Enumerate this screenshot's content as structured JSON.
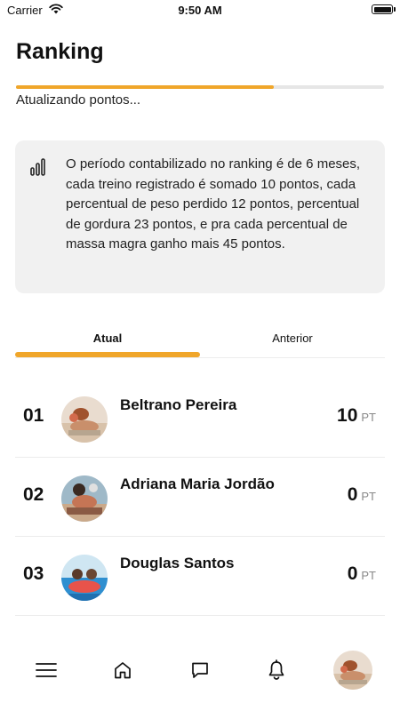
{
  "status_bar": {
    "carrier": "Carrier",
    "time": "9:50 AM"
  },
  "header": {
    "title": "Ranking"
  },
  "progress": {
    "value_fraction": 0.7,
    "label": "Atualizando pontos..."
  },
  "info": {
    "icon": "chart-bars-icon",
    "text": "O período contabilizado no ranking é de 6 meses, cada treino registrado é somado 10 pontos, cada percentual de peso perdido 12 pontos, percentual de gordura 23 pontos, e pra cada percentual de massa magra ganho mais 45 pontos."
  },
  "tabs": [
    {
      "label": "Atual",
      "selected": true
    },
    {
      "label": "Anterior",
      "selected": false
    }
  ],
  "ranking": [
    {
      "position": "01",
      "name": "Beltrano Pereira",
      "score": "10",
      "unit": "PT"
    },
    {
      "position": "02",
      "name": "Adriana Maria Jordão",
      "score": "0",
      "unit": "PT"
    },
    {
      "position": "03",
      "name": "Douglas Santos",
      "score": "0",
      "unit": "PT"
    }
  ],
  "bottom_nav": [
    {
      "icon": "menu-icon"
    },
    {
      "icon": "home-icon"
    },
    {
      "icon": "chat-icon"
    },
    {
      "icon": "bell-icon"
    },
    {
      "icon": "profile-avatar"
    }
  ],
  "colors": {
    "accent": "#f0a62a",
    "card_bg": "#f1f1f1",
    "muted": "#888888"
  }
}
